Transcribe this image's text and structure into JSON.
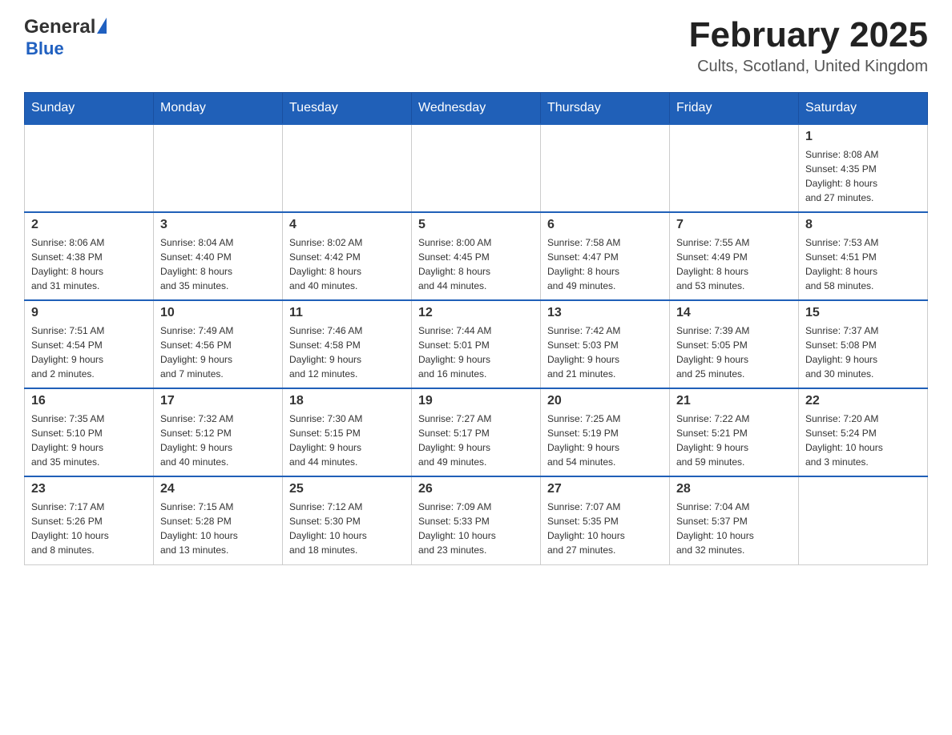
{
  "header": {
    "logo_general": "General",
    "logo_blue": "Blue",
    "month_title": "February 2025",
    "location": "Cults, Scotland, United Kingdom"
  },
  "days_of_week": [
    "Sunday",
    "Monday",
    "Tuesday",
    "Wednesday",
    "Thursday",
    "Friday",
    "Saturday"
  ],
  "weeks": [
    {
      "days": [
        {
          "number": "",
          "info": ""
        },
        {
          "number": "",
          "info": ""
        },
        {
          "number": "",
          "info": ""
        },
        {
          "number": "",
          "info": ""
        },
        {
          "number": "",
          "info": ""
        },
        {
          "number": "",
          "info": ""
        },
        {
          "number": "1",
          "info": "Sunrise: 8:08 AM\nSunset: 4:35 PM\nDaylight: 8 hours\nand 27 minutes."
        }
      ]
    },
    {
      "days": [
        {
          "number": "2",
          "info": "Sunrise: 8:06 AM\nSunset: 4:38 PM\nDaylight: 8 hours\nand 31 minutes."
        },
        {
          "number": "3",
          "info": "Sunrise: 8:04 AM\nSunset: 4:40 PM\nDaylight: 8 hours\nand 35 minutes."
        },
        {
          "number": "4",
          "info": "Sunrise: 8:02 AM\nSunset: 4:42 PM\nDaylight: 8 hours\nand 40 minutes."
        },
        {
          "number": "5",
          "info": "Sunrise: 8:00 AM\nSunset: 4:45 PM\nDaylight: 8 hours\nand 44 minutes."
        },
        {
          "number": "6",
          "info": "Sunrise: 7:58 AM\nSunset: 4:47 PM\nDaylight: 8 hours\nand 49 minutes."
        },
        {
          "number": "7",
          "info": "Sunrise: 7:55 AM\nSunset: 4:49 PM\nDaylight: 8 hours\nand 53 minutes."
        },
        {
          "number": "8",
          "info": "Sunrise: 7:53 AM\nSunset: 4:51 PM\nDaylight: 8 hours\nand 58 minutes."
        }
      ]
    },
    {
      "days": [
        {
          "number": "9",
          "info": "Sunrise: 7:51 AM\nSunset: 4:54 PM\nDaylight: 9 hours\nand 2 minutes."
        },
        {
          "number": "10",
          "info": "Sunrise: 7:49 AM\nSunset: 4:56 PM\nDaylight: 9 hours\nand 7 minutes."
        },
        {
          "number": "11",
          "info": "Sunrise: 7:46 AM\nSunset: 4:58 PM\nDaylight: 9 hours\nand 12 minutes."
        },
        {
          "number": "12",
          "info": "Sunrise: 7:44 AM\nSunset: 5:01 PM\nDaylight: 9 hours\nand 16 minutes."
        },
        {
          "number": "13",
          "info": "Sunrise: 7:42 AM\nSunset: 5:03 PM\nDaylight: 9 hours\nand 21 minutes."
        },
        {
          "number": "14",
          "info": "Sunrise: 7:39 AM\nSunset: 5:05 PM\nDaylight: 9 hours\nand 25 minutes."
        },
        {
          "number": "15",
          "info": "Sunrise: 7:37 AM\nSunset: 5:08 PM\nDaylight: 9 hours\nand 30 minutes."
        }
      ]
    },
    {
      "days": [
        {
          "number": "16",
          "info": "Sunrise: 7:35 AM\nSunset: 5:10 PM\nDaylight: 9 hours\nand 35 minutes."
        },
        {
          "number": "17",
          "info": "Sunrise: 7:32 AM\nSunset: 5:12 PM\nDaylight: 9 hours\nand 40 minutes."
        },
        {
          "number": "18",
          "info": "Sunrise: 7:30 AM\nSunset: 5:15 PM\nDaylight: 9 hours\nand 44 minutes."
        },
        {
          "number": "19",
          "info": "Sunrise: 7:27 AM\nSunset: 5:17 PM\nDaylight: 9 hours\nand 49 minutes."
        },
        {
          "number": "20",
          "info": "Sunrise: 7:25 AM\nSunset: 5:19 PM\nDaylight: 9 hours\nand 54 minutes."
        },
        {
          "number": "21",
          "info": "Sunrise: 7:22 AM\nSunset: 5:21 PM\nDaylight: 9 hours\nand 59 minutes."
        },
        {
          "number": "22",
          "info": "Sunrise: 7:20 AM\nSunset: 5:24 PM\nDaylight: 10 hours\nand 3 minutes."
        }
      ]
    },
    {
      "days": [
        {
          "number": "23",
          "info": "Sunrise: 7:17 AM\nSunset: 5:26 PM\nDaylight: 10 hours\nand 8 minutes."
        },
        {
          "number": "24",
          "info": "Sunrise: 7:15 AM\nSunset: 5:28 PM\nDaylight: 10 hours\nand 13 minutes."
        },
        {
          "number": "25",
          "info": "Sunrise: 7:12 AM\nSunset: 5:30 PM\nDaylight: 10 hours\nand 18 minutes."
        },
        {
          "number": "26",
          "info": "Sunrise: 7:09 AM\nSunset: 5:33 PM\nDaylight: 10 hours\nand 23 minutes."
        },
        {
          "number": "27",
          "info": "Sunrise: 7:07 AM\nSunset: 5:35 PM\nDaylight: 10 hours\nand 27 minutes."
        },
        {
          "number": "28",
          "info": "Sunrise: 7:04 AM\nSunset: 5:37 PM\nDaylight: 10 hours\nand 32 minutes."
        },
        {
          "number": "",
          "info": ""
        }
      ]
    }
  ]
}
